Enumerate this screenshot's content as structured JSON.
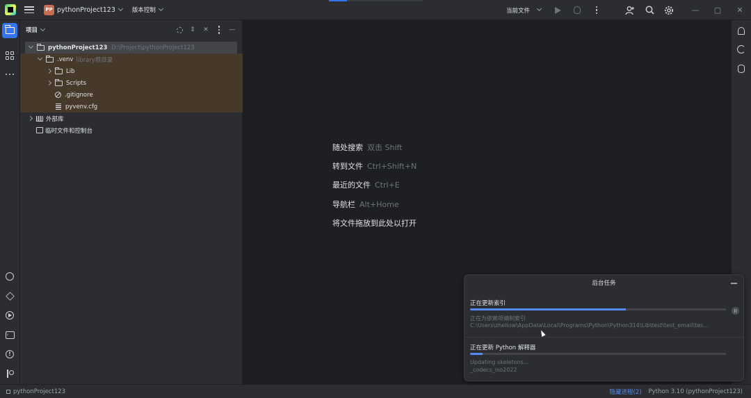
{
  "titlebar": {
    "project_badge": "PP",
    "project_name": "pythonProject123",
    "vcs_label": "版本控制",
    "run_config_label": "当前文件",
    "icons": [
      "hamburger-menu-icon",
      "play-icon",
      "debug-icon",
      "more-icon",
      "add-user-icon",
      "search-icon",
      "settings-icon"
    ],
    "window_controls": [
      "—",
      "▢",
      "✕"
    ]
  },
  "left_strip": {
    "items": [
      "project-folder-icon",
      "structure-icon",
      "more-tools-icon",
      "python-console-icon",
      "python-packages-icon",
      "services-icon",
      "terminal-icon",
      "problems-icon",
      "git-icon"
    ]
  },
  "project_panel": {
    "title": "项目",
    "tree": [
      {
        "label": "pythonProject123",
        "hint": "D:\\Project\\pythonProject123"
      },
      {
        "label": ".venv",
        "hint": "library根目录"
      },
      {
        "label": "Lib"
      },
      {
        "label": "Scripts"
      },
      {
        "label": ".gitignore"
      },
      {
        "label": "pyvenv.cfg"
      },
      {
        "label": "外部库"
      },
      {
        "label": "临时文件和控制台"
      }
    ]
  },
  "editor": {
    "hints": [
      {
        "action": "随处搜索",
        "shortcut": "双击 Shift"
      },
      {
        "action": "转到文件",
        "shortcut": "Ctrl+Shift+N"
      },
      {
        "action": "最近的文件",
        "shortcut": "Ctrl+E"
      },
      {
        "action": "导航栏",
        "shortcut": "Alt+Home"
      },
      {
        "action": "将文件拖放到此处以打开",
        "shortcut": ""
      }
    ]
  },
  "right_strip": {
    "items": [
      "notifications-icon",
      "ai-assistant-icon",
      "database-icon"
    ]
  },
  "background_tasks": {
    "title": "后台任务",
    "tasks": [
      {
        "title": "正在更新索引",
        "progress": 0.61,
        "line1": "正在为依赖项编制索引",
        "line2": "C:\\Users\\zhellow\\AppData\\Local\\Programs\\Python\\Python314\\Lib\\test\\test_email\\tes..."
      },
      {
        "title": "正在更新 Python 解释器",
        "progress": 0.05,
        "line1": "Updating skeletons...",
        "line2": "_codecs_iso2022"
      }
    ]
  },
  "statusbar": {
    "project": "pythonProject123",
    "hide_processes": "隐藏进程(2)",
    "interpreter": "Python 3.10 (pythonProject123)"
  },
  "colors": {
    "accent": "#3574f0",
    "background": "#1e1f22",
    "panel": "#2b2d30",
    "excluded_highlight": "#46392a",
    "project_badge": "#c96c4f"
  }
}
